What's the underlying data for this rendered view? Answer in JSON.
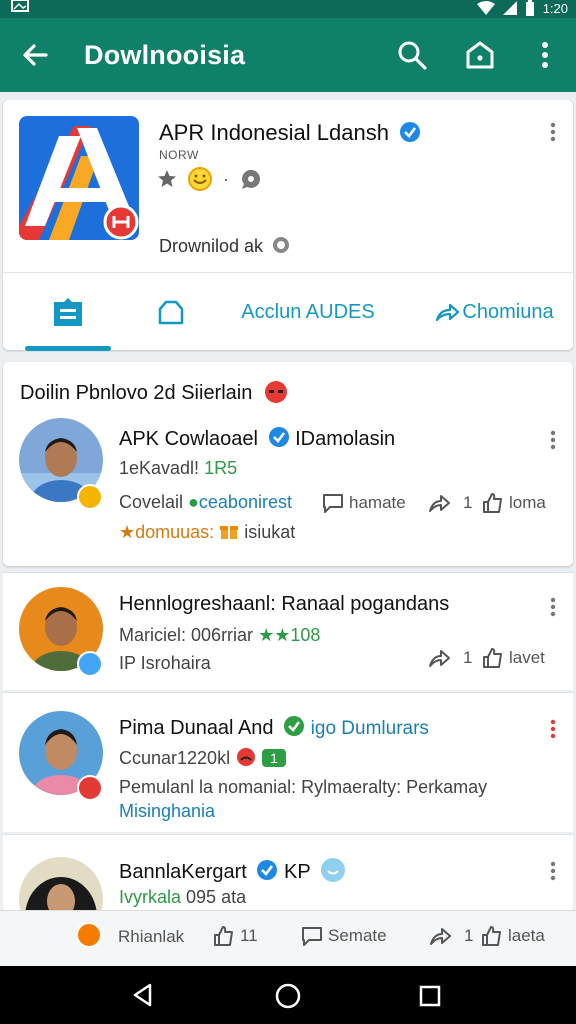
{
  "status_bar": {
    "time": "1:20"
  },
  "app_bar": {
    "title": "Dowlnooisia"
  },
  "app_card": {
    "name": "APR Indonesial Ldansh",
    "subtitle": "NORW",
    "download_text": "Drownilod ak",
    "tabs": [
      {
        "label": "",
        "icon": "menu-tab-icon",
        "active": true
      },
      {
        "label": "",
        "icon": "home-outline-icon",
        "active": false
      },
      {
        "label": "Acclun AUDES",
        "active": false
      },
      {
        "label": "Chomiuna",
        "icon": "share-arrow-icon",
        "active": false
      }
    ]
  },
  "feed": {
    "section_title": "Doilin Pbnlovo 2d Siierlain",
    "posts": [
      {
        "name": "APK Cowlaoael",
        "name_suffix": "IDamolasin",
        "line1_a": "1eKavadl! ",
        "line1_b": "1R5",
        "line2_a": "Covelail ",
        "line2_b": "ceabonirest",
        "line2_c": "hamate",
        "share_count": "1",
        "like_label": "loma",
        "line3_a": "★domuuas:",
        "line3_b": "isiukat"
      },
      {
        "name": "Hennlogreshaanl: Ranaal pogandans",
        "line1_a": "Mariciel: ",
        "line1_b": "006",
        "line1_c": "rriar",
        "line1_d": "★★108",
        "line2": "IP Isrohaira",
        "share_count": "1",
        "like_label": "lavet"
      },
      {
        "name": "Pima Dunaal And",
        "name_suffix": "igo Dumlurars",
        "line1": "Ccunar1220kl",
        "badge": "1",
        "line2": "Pemulanl la nomanial: Rylmaeralty: Perkamay",
        "line3": "Misinghania"
      },
      {
        "name": "BannlaKergart",
        "name_suffix": "KP",
        "line1_a": "Ivyrkala",
        "line1_b": "095 ata"
      }
    ]
  },
  "bottom_actions": {
    "left_label": "Rhianlak",
    "like_count": "11",
    "comment_label": "Semate",
    "share_count": "1",
    "like_label": "laeta"
  }
}
